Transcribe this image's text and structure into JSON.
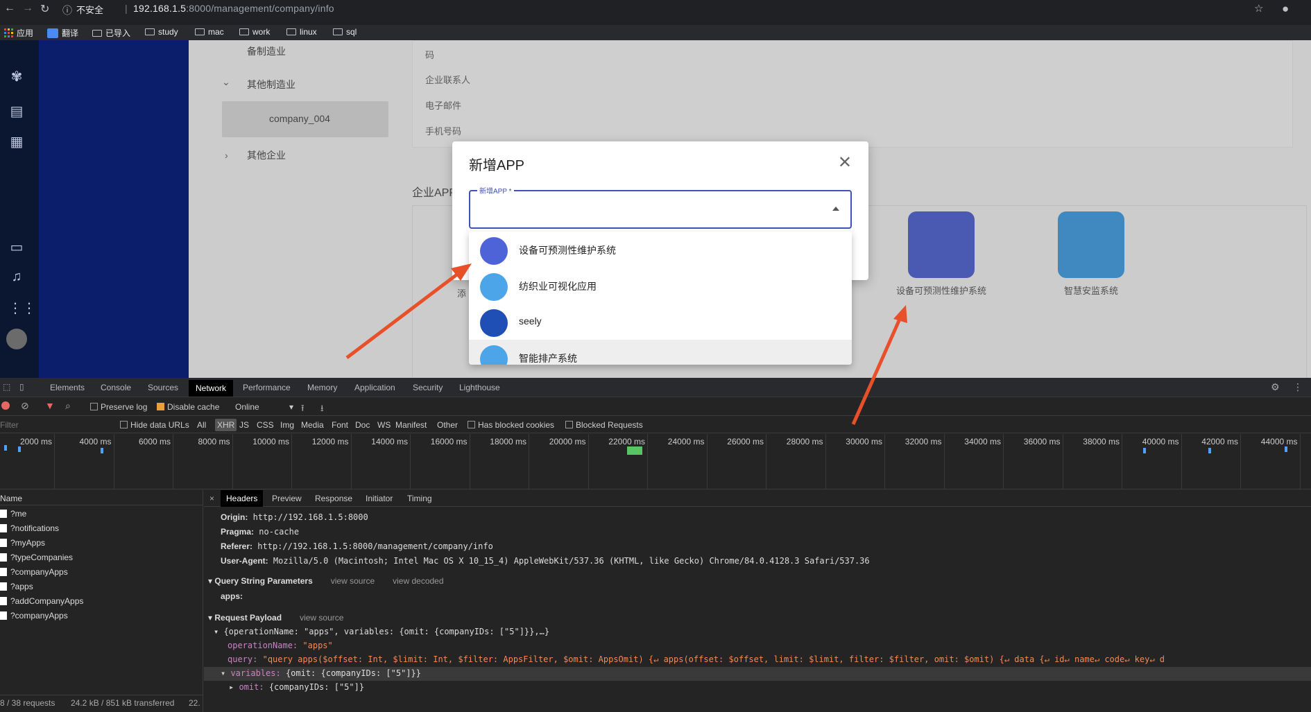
{
  "browser": {
    "security": "不安全",
    "url_host": "192.168.1.5",
    "url_rest": ":8000/management/company/info",
    "bookmarks": [
      "应用",
      "翻译",
      "已导入",
      "study",
      "mac",
      "work",
      "linux",
      "sql"
    ]
  },
  "tree": {
    "item1": "备制造业",
    "item2": "其他制造业",
    "selected": "company_004",
    "item3": "其他企业"
  },
  "info_labels": [
    "码",
    "企业联系人",
    "电子邮件",
    "手机号码"
  ],
  "section_title": "企业APP",
  "add_label_partial": "添",
  "apps_bg": [
    {
      "label": "设备可预测性维护系统",
      "color": "#3b4fc4"
    },
    {
      "label": "智慧安监系统",
      "color": "#2d8ed8"
    }
  ],
  "modal": {
    "title": "新增APP",
    "field_label": "新增APP *",
    "close": "✕"
  },
  "dropdown": [
    {
      "label": "设备可预测性维护系统",
      "color": "#4f63d8"
    },
    {
      "label": "纺织业可视化应用",
      "color": "#4ba5e8"
    },
    {
      "label": "seely",
      "color": "#1f4fb5"
    },
    {
      "label": "智能排产系统",
      "color": "#4ba5e8"
    }
  ],
  "devtools": {
    "tabs": [
      "Elements",
      "Console",
      "Sources",
      "Network",
      "Performance",
      "Memory",
      "Application",
      "Security",
      "Lighthouse"
    ],
    "toolbar": {
      "preserve_log": "Preserve log",
      "disable_cache": "Disable cache",
      "online": "Online"
    },
    "filter": {
      "placeholder": "Filter",
      "hide_data_urls": "Hide data URLs",
      "types": [
        "All",
        "XHR",
        "JS",
        "CSS",
        "Img",
        "Media",
        "Font",
        "Doc",
        "WS",
        "Manifest",
        "Other"
      ],
      "blocked_cookies": "Has blocked cookies",
      "blocked_requests": "Blocked Requests"
    },
    "ticks": [
      "2000 ms",
      "4000 ms",
      "6000 ms",
      "8000 ms",
      "10000 ms",
      "12000 ms",
      "14000 ms",
      "16000 ms",
      "18000 ms",
      "20000 ms",
      "22000 ms",
      "24000 ms",
      "26000 ms",
      "28000 ms",
      "30000 ms",
      "32000 ms",
      "34000 ms",
      "36000 ms",
      "38000 ms",
      "40000 ms",
      "42000 ms",
      "44000 ms"
    ],
    "name_header": "Name",
    "requests": [
      "?me",
      "?notifications",
      "?myApps",
      "?typeCompanies",
      "?companyApps",
      "?apps",
      "?addCompanyApps",
      "?companyApps"
    ],
    "status": {
      "requests": "8 / 38 requests",
      "transfer": "24.2 kB / 851 kB transferred",
      "extra": "22."
    },
    "detail_tabs": [
      "Headers",
      "Preview",
      "Response",
      "Initiator",
      "Timing"
    ],
    "headers": [
      {
        "k": "Origin:",
        "v": "http://192.168.1.5:8000"
      },
      {
        "k": "Pragma:",
        "v": "no-cache"
      },
      {
        "k": "Referer:",
        "v": "http://192.168.1.5:8000/management/company/info"
      },
      {
        "k": "User-Agent:",
        "v": "Mozilla/5.0 (Macintosh; Intel Mac OS X 10_15_4) AppleWebKit/537.36 (KHTML, like Gecko) Chrome/84.0.4128.3 Safari/537.36"
      }
    ],
    "qsp": {
      "title": "Query String Parameters",
      "view_source": "view source",
      "view_decoded": "view decoded",
      "apps": "apps:"
    },
    "payload": {
      "title": "Request Payload",
      "view_source": "view source",
      "summary": "{operationName: \"apps\", variables: {omit: {companyIDs: [\"5\"]}},…}",
      "op_key": "operationName:",
      "op_val": "\"apps\"",
      "query_key": "query:",
      "query_val": "\"query apps($offset: Int, $limit: Int, $filter: AppsFilter, $omit: AppsOmit) {↵  apps(offset: $offset, limit: $limit, filter: $filter, omit: $omit) {↵    data {↵      id↵      name↵      code↵      key↵      d",
      "vars_key": "variables:",
      "vars_val": "{omit: {companyIDs: [\"5\"]}}",
      "omit_key": "omit:",
      "omit_val": "{companyIDs: [\"5\"]}"
    }
  }
}
